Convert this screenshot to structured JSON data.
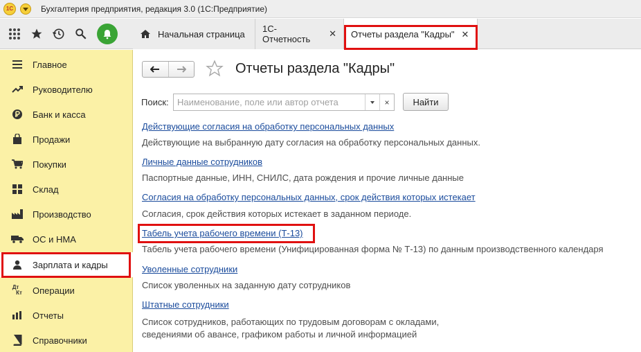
{
  "window": {
    "title": "Бухгалтерия предприятия, редакция 3.0 (1С:Предприятие)",
    "logo_text": "1С"
  },
  "toolbar": {
    "icons": [
      "apps-grid-icon",
      "star-icon",
      "history-icon",
      "search-icon",
      "bell-icon"
    ]
  },
  "tabs": [
    {
      "label": "Начальная страница",
      "icon": "home-icon",
      "closable": false
    },
    {
      "label": "1С-Отчетность",
      "closable": true
    },
    {
      "label": "Отчеты раздела \"Кадры\"",
      "closable": true,
      "active": true
    }
  ],
  "sidebar": {
    "items": [
      {
        "label": "Главное",
        "icon": "menu-lines-icon"
      },
      {
        "label": "Руководителю",
        "icon": "trend-up-icon"
      },
      {
        "label": "Банк и касса",
        "icon": "ruble-coin-icon"
      },
      {
        "label": "Продажи",
        "icon": "shopping-bag-icon"
      },
      {
        "label": "Покупки",
        "icon": "cart-icon"
      },
      {
        "label": "Склад",
        "icon": "warehouse-grid-icon"
      },
      {
        "label": "Производство",
        "icon": "factory-icon"
      },
      {
        "label": "ОС и НМА",
        "icon": "truck-icon"
      },
      {
        "label": "Зарплата и кадры",
        "icon": "person-icon",
        "selected": true
      },
      {
        "label": "Операции",
        "icon": "debit-credit-icon"
      },
      {
        "label": "Отчеты",
        "icon": "bar-chart-icon"
      },
      {
        "label": "Справочники",
        "icon": "book-icon"
      }
    ],
    "debit_credit_text": {
      "top": "Дт",
      "bottom": "Кт"
    }
  },
  "main": {
    "title": "Отчеты раздела \"Кадры\"",
    "search": {
      "label": "Поиск:",
      "placeholder": "Наименование, поле или автор отчета",
      "value": "",
      "clear_label": "×",
      "find_label": "Найти"
    },
    "reports": [
      {
        "title": "Действующие согласия на обработку персональных данных",
        "description": "Действующие на выбранную дату согласия на обработку персональных данных."
      },
      {
        "title": "Личные данные сотрудников",
        "description": "Паспортные данные, ИНН, СНИЛС, дата рождения и прочие личные данные"
      },
      {
        "title": "Согласия на обработку персональных данных, срок действия которых истекает",
        "description": "Согласия, срок действия которых истекает в заданном периоде."
      },
      {
        "title": "Табель учета рабочего времени (Т-13)",
        "description": "Табель учета рабочего времени (Унифицированная форма № Т-13) по данным производственного календаря",
        "highlighted": true
      },
      {
        "title": "Уволенные сотрудники",
        "description": "Список уволенных на заданную дату сотрудников"
      },
      {
        "title": "Штатные сотрудники",
        "description": "Список сотрудников, работающих по трудовым договорам с окладами,",
        "description_line2": "сведениями об авансе, графиком работы и личной информацией"
      }
    ]
  },
  "colors": {
    "sidebar_bg": "#fbf1a6",
    "link": "#1a4b9c",
    "highlight_frame": "#e01010",
    "bell_green": "#3aa435"
  }
}
